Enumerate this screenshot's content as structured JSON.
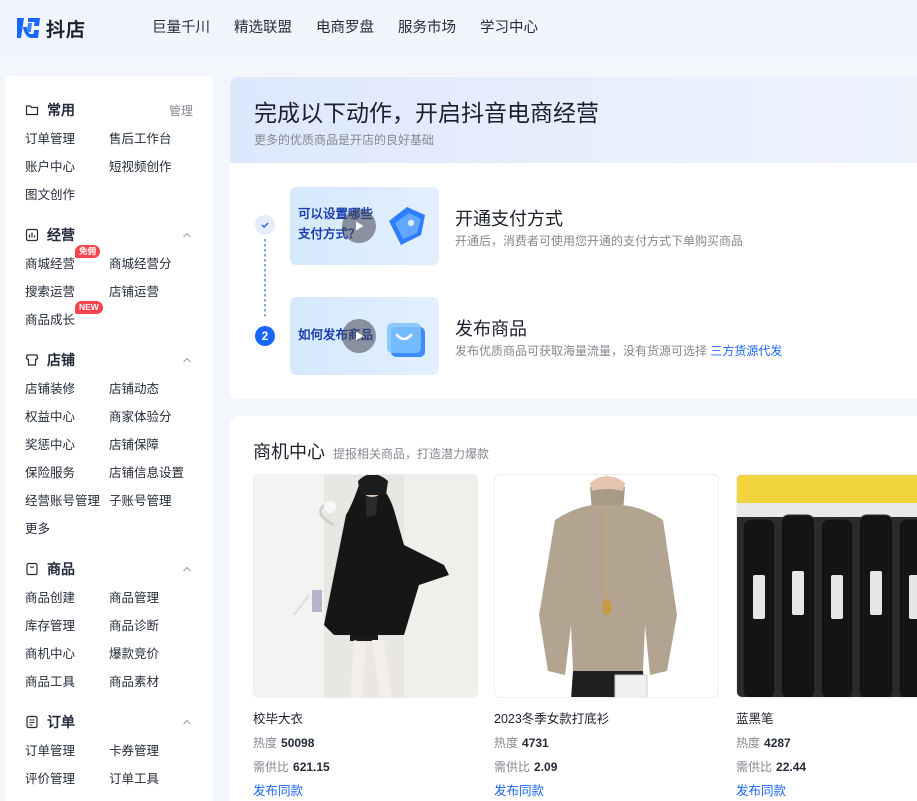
{
  "app": {
    "logo_text": "抖店"
  },
  "topnav": [
    "巨量千川",
    "精选联盟",
    "电商罗盘",
    "服务市场",
    "学习中心"
  ],
  "sidebar": {
    "sections": [
      {
        "title": "常用",
        "right": "管理",
        "items": [
          "订单管理",
          "售后工作台",
          "账户中心",
          "短视频创作",
          "图文创作"
        ]
      },
      {
        "title": "经营",
        "items": [
          "商城经营",
          "商城经营分",
          "搜索运营",
          "店铺运营",
          "商品成长"
        ],
        "badges": {
          "0": "免佣",
          "4": "NEW"
        }
      },
      {
        "title": "店铺",
        "items": [
          "店铺装修",
          "店铺动态",
          "权益中心",
          "商家体验分",
          "奖惩中心",
          "店铺保障",
          "保险服务",
          "店铺信息设置",
          "经营账号管理",
          "子账号管理",
          "更多"
        ]
      },
      {
        "title": "商品",
        "items": [
          "商品创建",
          "商品管理",
          "库存管理",
          "商品诊断",
          "商机中心",
          "爆款竞价",
          "商品工具",
          "商品素材"
        ]
      },
      {
        "title": "订单",
        "items": [
          "订单管理",
          "卡券管理",
          "评价管理",
          "订单工具"
        ]
      }
    ]
  },
  "hero": {
    "title": "完成以下动作，开启抖音电商经营",
    "subtitle": "更多的优质商品是开店的良好基础",
    "steps": [
      {
        "state": "done",
        "thumb_text_1": "可以设置哪些",
        "thumb_text_2": "支付方式？",
        "title": "开通支付方式",
        "desc": "开通后，消费者可使用您开通的支付方式下单购买商品"
      },
      {
        "state": "todo",
        "number": "2",
        "thumb_text_1": "如何发布商品",
        "title": "发布商品",
        "desc": "发布优质商品可获取海量流量，没有货源可选择 ",
        "link": "三方货源代发"
      }
    ]
  },
  "opportunity": {
    "title": "商机中心",
    "subtitle": "提报相关商品，打造潜力爆款",
    "heat_label": "热度",
    "ratio_label": "需供比",
    "action_label": "发布同款",
    "products": [
      {
        "name": "校毕大衣",
        "heat": "50098",
        "ratio": "621.15"
      },
      {
        "name": "2023冬季女款打底衫",
        "heat": "4731",
        "ratio": "2.09"
      },
      {
        "name": "蓝黑笔",
        "heat": "4287",
        "ratio": "22.44"
      }
    ]
  },
  "colors": {
    "accent": "#1966ff",
    "badge": "#f5444e"
  }
}
